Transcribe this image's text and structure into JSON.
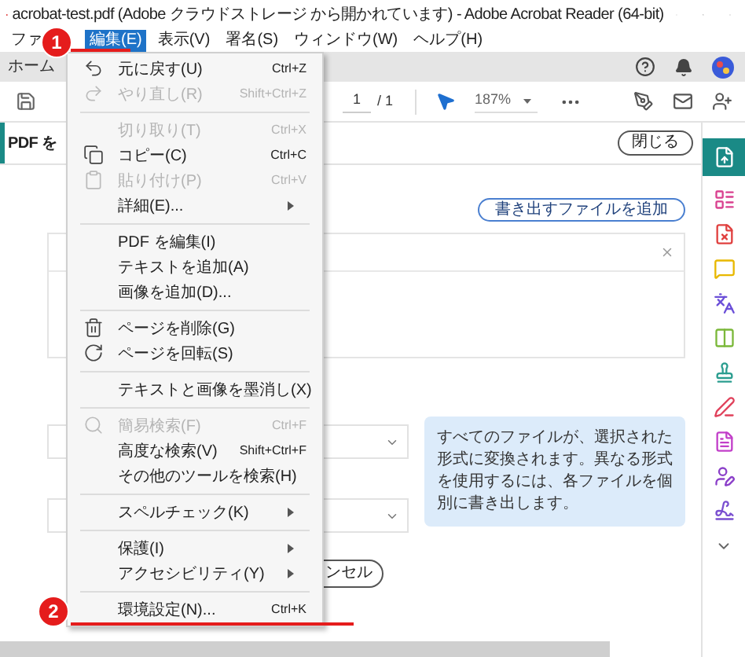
{
  "window": {
    "title": "acrobat-test.pdf (Adobe クラウドストレージ から開かれています) - Adobe Acrobat Reader (64-bit)"
  },
  "menu_bar": [
    {
      "label": "ファ",
      "selected": false
    },
    {
      "label": "編集(E)",
      "selected": true
    },
    {
      "label": "表示(V)",
      "selected": false
    },
    {
      "label": "署名(S)",
      "selected": false
    },
    {
      "label": "ウィンドウ(W)",
      "selected": false
    },
    {
      "label": "ヘルプ(H)",
      "selected": false
    }
  ],
  "tab_bar": {
    "tab": "ホーム"
  },
  "toolbar": {
    "page": "1",
    "page_count": "/ 1",
    "zoom": "187%"
  },
  "panel": {
    "title": "PDF を",
    "close_button": "閉じる",
    "add_files_button": "書き出すファイルを追加",
    "info": "すべてのファイルが、選択された形式に変換されます。異なる形式を使用するには、各ファイルを個別に書き出します。",
    "cancel_button": "ンセル"
  },
  "edit_menu": [
    {
      "kind": "item",
      "label": "元に戻す(U)",
      "shortcut": "Ctrl+Z",
      "disabled": false,
      "submenu": false
    },
    {
      "kind": "item",
      "label": "やり直し(R)",
      "shortcut": "Shift+Ctrl+Z",
      "disabled": true,
      "submenu": false
    },
    {
      "kind": "separator"
    },
    {
      "kind": "item",
      "label": "切り取り(T)",
      "shortcut": "Ctrl+X",
      "disabled": true,
      "submenu": false
    },
    {
      "kind": "item",
      "label": "コピー(C)",
      "shortcut": "Ctrl+C",
      "disabled": false,
      "submenu": false
    },
    {
      "kind": "item",
      "label": "貼り付け(P)",
      "shortcut": "Ctrl+V",
      "disabled": true,
      "submenu": false
    },
    {
      "kind": "item",
      "label": "詳細(E)...",
      "disabled": false,
      "submenu": true
    },
    {
      "kind": "separator"
    },
    {
      "kind": "item",
      "label": "PDF を編集(I)",
      "disabled": false,
      "submenu": false
    },
    {
      "kind": "item",
      "label": "テキストを追加(A)",
      "disabled": false,
      "submenu": false
    },
    {
      "kind": "item",
      "label": "画像を追加(D)...",
      "disabled": false,
      "submenu": false
    },
    {
      "kind": "separator"
    },
    {
      "kind": "item",
      "label": "ページを削除(G)",
      "disabled": false,
      "submenu": false
    },
    {
      "kind": "item",
      "label": "ページを回転(S)",
      "disabled": false,
      "submenu": false
    },
    {
      "kind": "separator"
    },
    {
      "kind": "item",
      "label": "テキストと画像を墨消し(X)",
      "disabled": false,
      "submenu": false
    },
    {
      "kind": "separator"
    },
    {
      "kind": "item",
      "label": "簡易検索(F)",
      "shortcut": "Ctrl+F",
      "disabled": true,
      "submenu": false
    },
    {
      "kind": "item",
      "label": "高度な検索(V)",
      "shortcut": "Shift+Ctrl+F",
      "disabled": false,
      "submenu": false
    },
    {
      "kind": "item",
      "label": "その他のツールを検索(H)",
      "disabled": false,
      "submenu": false
    },
    {
      "kind": "separator"
    },
    {
      "kind": "item",
      "label": "スペルチェック(K)",
      "disabled": false,
      "submenu": true
    },
    {
      "kind": "separator"
    },
    {
      "kind": "item",
      "label": "保護(I)",
      "disabled": false,
      "submenu": true
    },
    {
      "kind": "item",
      "label": "アクセシビリティ(Y)",
      "disabled": false,
      "submenu": true
    },
    {
      "kind": "separator"
    },
    {
      "kind": "item",
      "label": "環境設定(N)...",
      "shortcut": "Ctrl+K",
      "disabled": false,
      "submenu": false
    }
  ],
  "annotations": [
    {
      "number": "1"
    },
    {
      "number": "2"
    }
  ]
}
